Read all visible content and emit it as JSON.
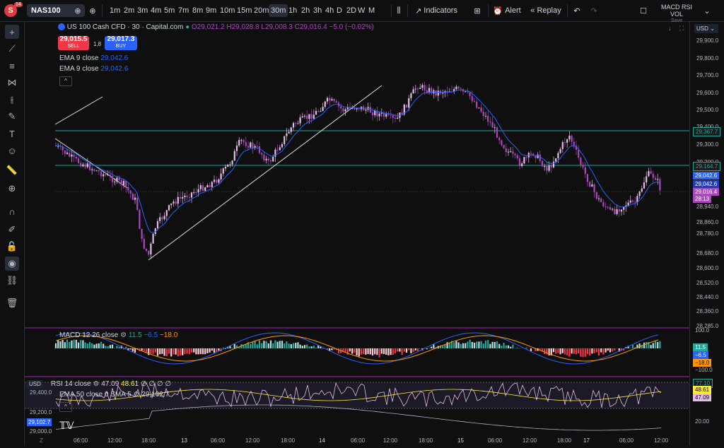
{
  "header": {
    "logo_letter": "S",
    "logo_badge": "14",
    "symbol": "NAS100",
    "timeframes": [
      "1m",
      "2m",
      "3m",
      "4m",
      "5m",
      "7m",
      "8m",
      "9m",
      "10m",
      "15m",
      "20m",
      "30m",
      "1h",
      "2h",
      "3h",
      "4h",
      "D",
      "2D",
      "W",
      "M"
    ],
    "active_timeframe": "30m",
    "indicators_label": "Indicators",
    "alert_label": "Alert",
    "replay_label": "Replay",
    "layout_name": "MACD RSI VOL",
    "layout_save": "Save"
  },
  "legend": {
    "title": "US 100 Cash CFD · 30 · Capital.com",
    "ohlc": "O29,021.2 H29,028.8 L29,008.3 C29,016.4 −5.0 (−0.02%)",
    "sell_price": "29,015.5",
    "sell_label": "SELL",
    "spread": "1.8",
    "buy_price": "29,017.3",
    "buy_label": "BUY",
    "ema1_label": "EMA 9 close",
    "ema1_value": "29,042.6",
    "ema2_label": "EMA 9 close",
    "ema2_value": "29,042.6"
  },
  "currency": "USD",
  "price_axis": [
    "29,900.0",
    "29,800.0",
    "29,700.0",
    "29,600.0",
    "29,500.0",
    "29,400.0",
    "29,300.0",
    "29,200.0",
    "29,020.0",
    "28,940.0",
    "28,860.0",
    "28,780.0",
    "28,680.0",
    "28,600.0",
    "28,520.0",
    "28,440.0",
    "28,360.0",
    "28,285.0"
  ],
  "price_tags": {
    "line1": "29,367.7",
    "line2": "29,164.7",
    "ema_a": "29,042.6",
    "ema_b": "29,042.6",
    "last": "29,016.4",
    "countdown": "28:13"
  },
  "macd": {
    "label": "MACD 12 26 close",
    "v1": "11.5",
    "v2": "−6.5",
    "v3": "−18.0",
    "axis_top": "100.0",
    "axis_bottom": "−100.0",
    "tag1": "11.5",
    "tag2": "−6.5",
    "tag3": "−18.0"
  },
  "rsi": {
    "currency": "USD",
    "label": "RSI 14 close",
    "v1": "47.09",
    "v2": "48.61",
    "dots": "∅ ∅ ∅ ∅",
    "ema_label": "EMA 50 close 0 SMA 5",
    "ema_value": "29,102.7",
    "axis_top": "77.10",
    "tag1": "48.61",
    "tag2": "47.09",
    "axis_bottom": "20.00",
    "left_axis": [
      "29,400.0",
      "29,200.0",
      "29,000.0"
    ],
    "left_tag": "29,102.7"
  },
  "time_axis": [
    "06:00",
    "12:00",
    "18:00",
    "13",
    "06:00",
    "12:00",
    "18:00",
    "14",
    "06:00",
    "12:00",
    "18:00",
    "15",
    "06:00",
    "12:00",
    "18:00",
    "17",
    "06:00",
    "12:00"
  ],
  "colors": {
    "bull": "#e1bee7",
    "bear": "#ab47bc",
    "ema": "#2962ff",
    "level": "#26a69a",
    "sell": "#f23645",
    "buy": "#2962ff"
  }
}
